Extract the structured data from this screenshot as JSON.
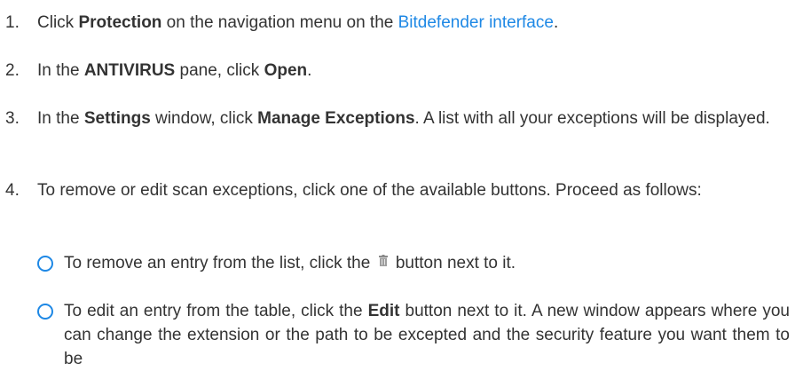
{
  "steps": [
    {
      "num": "1.",
      "t1": "Click ",
      "b1": "Protection",
      "t2": " on the navigation menu on the ",
      "link": "Bitdefender interface",
      "t3": "."
    },
    {
      "num": "2.",
      "t1": "In the ",
      "b1": "ANTIVIRUS",
      "t2": " pane, click ",
      "b2": "Open",
      "t3": "."
    },
    {
      "num": "3.",
      "t1": "In the ",
      "b1": "Settings",
      "t2": " window, click ",
      "b2": "Manage Exceptions",
      "t3": ". A list with all your exceptions will be displayed."
    },
    {
      "num": "4.",
      "t1": "To remove or edit scan exceptions, click one of the available buttons. Proceed as follows:"
    }
  ],
  "subitems": [
    {
      "t1": "To remove an entry from the list, click the ",
      "icon": "trash-icon",
      "t2": " button next to it."
    },
    {
      "t1": "To edit an entry from the table, click the ",
      "b1": "Edit",
      "t2": " button next to it. A new window appears where you can change the extension or the path to be excepted and the security feature you want them to be"
    }
  ],
  "colors": {
    "text": "#333333",
    "link": "#1e88e5",
    "bullet": "#1e88e5"
  }
}
